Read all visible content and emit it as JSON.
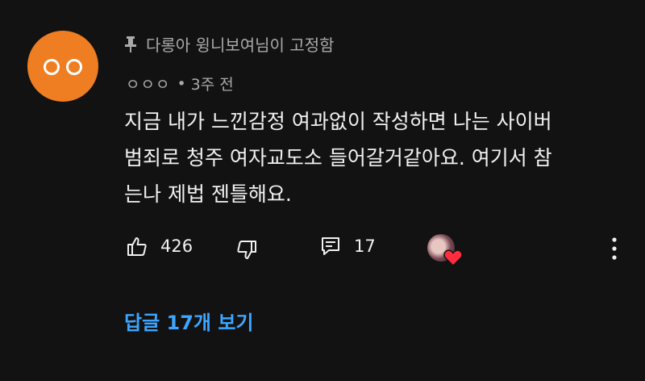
{
  "comment": {
    "avatar_color": "#ef7d22",
    "pinned_label": "다롱아 윙니보여님이 고정함",
    "author": "ㅇㅇㅇ",
    "separator": "•",
    "time": "3주 전",
    "text": "지금 내가 느낀감정 여과없이 작성하면 나는 사이버\n범죄로 청주 여자교도소 들어갈거같아요. 여기서 참\n는나 제법 젠틀해요.",
    "likes": "426",
    "replies_count": "17",
    "hearted_by_creator": true,
    "view_replies_label": "답글 17개 보기",
    "link_color": "#3ea6ff"
  }
}
